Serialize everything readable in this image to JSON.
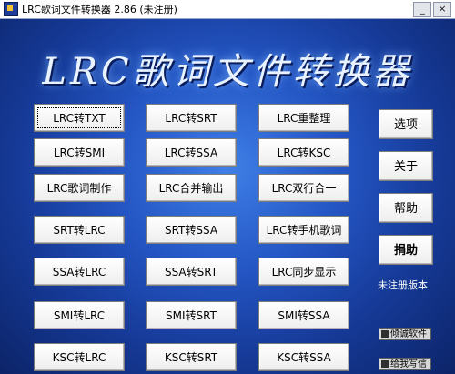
{
  "window": {
    "title": "LRC歌词文件转换器 2.86 (未注册)",
    "logo_text": "LRC歌词文件转换器"
  },
  "buttons": [
    "LRC转TXT",
    "LRC转SRT",
    "LRC重整理",
    "LRC转SMI",
    "LRC转SSA",
    "LRC转KSC",
    "LRC歌词制作",
    "LRC合并输出",
    "LRC双行合一",
    "SRT转LRC",
    "SRT转SSA",
    "LRC转手机歌词",
    "SSA转LRC",
    "SSA转SRT",
    "LRC同步显示",
    "SMI转LRC",
    "SMI转SRT",
    "SMI转SSA",
    "KSC转LRC",
    "KSC转SRT",
    "KSC转SSA"
  ],
  "side": {
    "options": "选项",
    "about": "关于",
    "help": "帮助",
    "donate": "捐助"
  },
  "status": "未注册版本",
  "links": {
    "software": "倾诚软件",
    "contact": "给我写信"
  }
}
